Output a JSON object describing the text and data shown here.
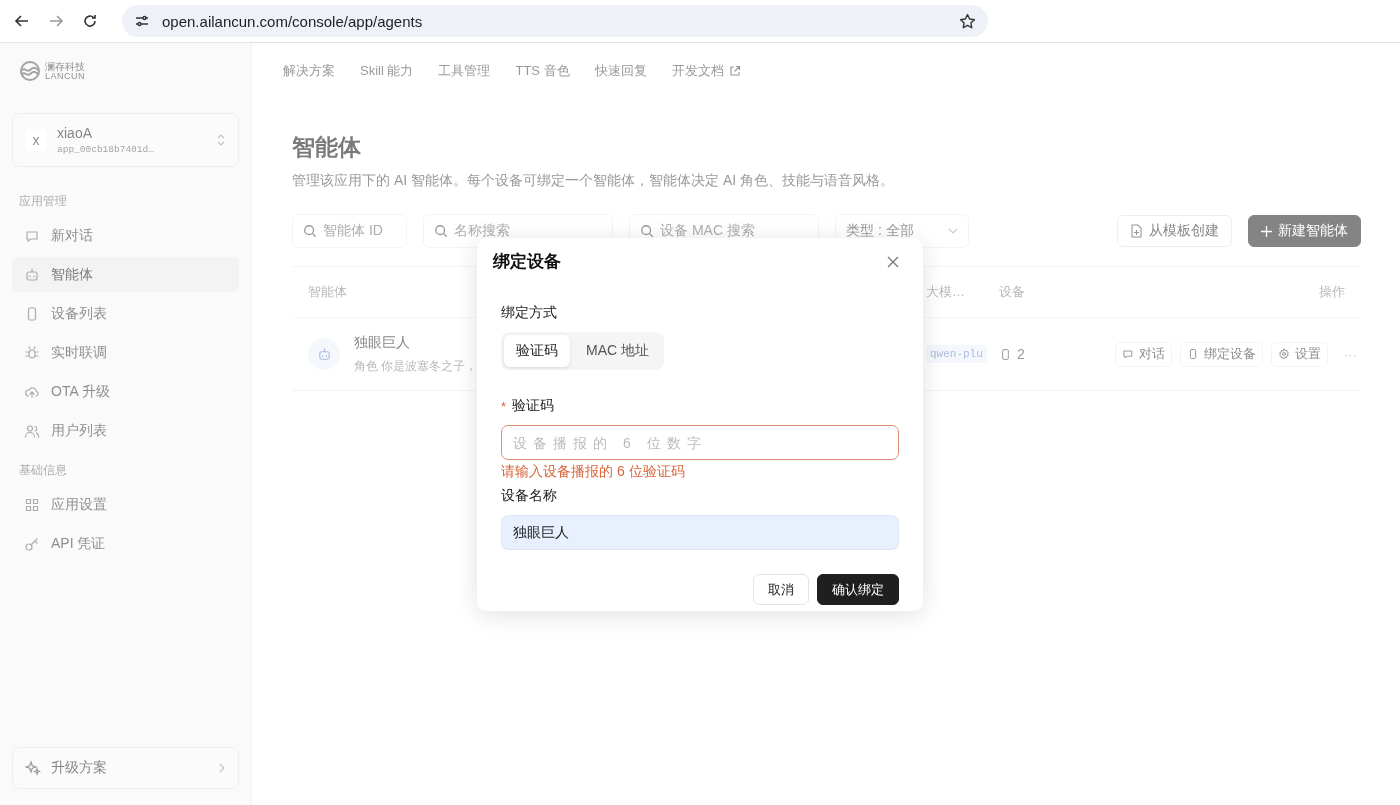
{
  "browser": {
    "url": "open.ailancun.com/console/app/agents"
  },
  "sidebar": {
    "logo": {
      "name": "澜存科技",
      "latin": "LANCUN"
    },
    "workspace": {
      "avatar": "x",
      "name": "xiaoA",
      "app_id": "app_00cb18b7401d…"
    },
    "sections": [
      {
        "title": "应用管理",
        "items": [
          {
            "label": "新对话",
            "selected": false
          },
          {
            "label": "智能体",
            "selected": true
          },
          {
            "label": "设备列表",
            "selected": false
          },
          {
            "label": "实时联调",
            "selected": false
          },
          {
            "label": "OTA 升级",
            "selected": false
          },
          {
            "label": "用户列表",
            "selected": false
          }
        ]
      },
      {
        "title": "基础信息",
        "items": [
          {
            "label": "应用设置",
            "selected": false
          },
          {
            "label": "API 凭证",
            "selected": false
          }
        ]
      }
    ],
    "upgrade": {
      "label": "升级方案"
    }
  },
  "top_nav": [
    {
      "label": "解决方案",
      "external": false
    },
    {
      "label": "Skill 能力",
      "external": false
    },
    {
      "label": "工具管理",
      "external": false
    },
    {
      "label": "TTS 音色",
      "external": false
    },
    {
      "label": "快速回复",
      "external": false
    },
    {
      "label": "开发文档",
      "external": true
    }
  ],
  "page": {
    "title": "智能体",
    "description": "管理该应用下的 AI 智能体。每个设备可绑定一个智能体，智能体决定 AI 角色、技能与语音风格。"
  },
  "filters": [
    {
      "kind": "search",
      "placeholder": "智能体 ID"
    },
    {
      "kind": "search",
      "placeholder": "名称搜索"
    },
    {
      "kind": "search",
      "placeholder": "设备 MAC 搜索"
    },
    {
      "kind": "select",
      "value": "类型 : 全部"
    }
  ],
  "actions": [
    {
      "label": "从模板创建",
      "kind": "secondary"
    },
    {
      "label": "新建智能体",
      "kind": "primary"
    }
  ],
  "table": {
    "columns": [
      "智能体",
      "大模…",
      "设备",
      "操作"
    ],
    "rows": [
      {
        "name": "独眼巨人",
        "description": "角色 你是波塞冬之子，",
        "model": "qwen-plu",
        "devices": "2",
        "actions": [
          {
            "label": "对话"
          },
          {
            "label": "绑定设备"
          },
          {
            "label": "设置"
          }
        ],
        "more": "···"
      }
    ]
  },
  "modal": {
    "title": "绑定设备",
    "method_label": "绑定方式",
    "methods": [
      {
        "label": "验证码",
        "selected": true
      },
      {
        "label": "MAC 地址",
        "selected": false
      }
    ],
    "code_field": {
      "required_mark": "*",
      "label": "验证码",
      "placeholder": "设备播报的 6 位数字",
      "error": "请输入设备播报的 6 位验证码"
    },
    "name_field": {
      "label": "设备名称",
      "value": "独眼巨人",
      "focused": true
    },
    "buttons": [
      {
        "label": "取消",
        "kind": "secondary"
      },
      {
        "label": "确认绑定",
        "kind": "primary"
      }
    ]
  }
}
